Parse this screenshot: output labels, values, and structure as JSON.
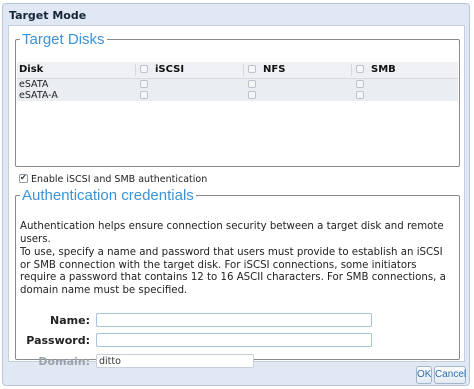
{
  "dialog": {
    "title": "Target Mode"
  },
  "target_disks": {
    "legend": "Target Disks",
    "columns": [
      "Disk",
      "iSCSI",
      "NFS",
      "SMB"
    ],
    "rows": [
      {
        "disk": "eSATA",
        "iscsi": false,
        "nfs": false,
        "smb": false
      },
      {
        "disk": "eSATA-A",
        "iscsi": false,
        "nfs": false,
        "smb": false
      }
    ]
  },
  "enable_auth": {
    "label": "Enable iSCSI and SMB authentication",
    "checked": true
  },
  "credentials": {
    "legend": "Authentication credentials",
    "intro": "Authentication helps ensure connection security between a target disk and remote users.",
    "instructions": "To use, specify a name and password that users must provide to establish an iSCSI or SMB connection with the target disk. For iSCSI connections, some initiators require a password that contains 12 to 16 ASCII characters. For SMB connections, a domain name must be specified.",
    "name_label": "Name:",
    "name_value": "",
    "password_label": "Password:",
    "password_value": "",
    "domain_label": "Domain:",
    "domain_value": "ditto"
  },
  "buttons": {
    "ok": "OK",
    "cancel": "Cancel"
  }
}
